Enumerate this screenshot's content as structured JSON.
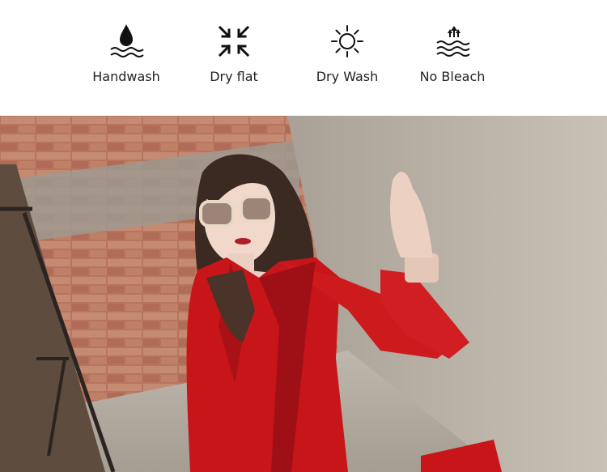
{
  "care_instructions": [
    {
      "label": "Handwash",
      "icon": "handwash-icon"
    },
    {
      "label": "Dry flat",
      "icon": "dry-flat-icon"
    },
    {
      "label": "Dry Wash",
      "icon": "dry-wash-sun-icon"
    },
    {
      "label": "No Bleach",
      "icon": "no-bleach-icon"
    }
  ],
  "photo": {
    "subject": "model-in-red-coat",
    "colors": {
      "coat": "#cc1616",
      "brick": "#b07060",
      "concrete": "#b9b1a6"
    }
  }
}
